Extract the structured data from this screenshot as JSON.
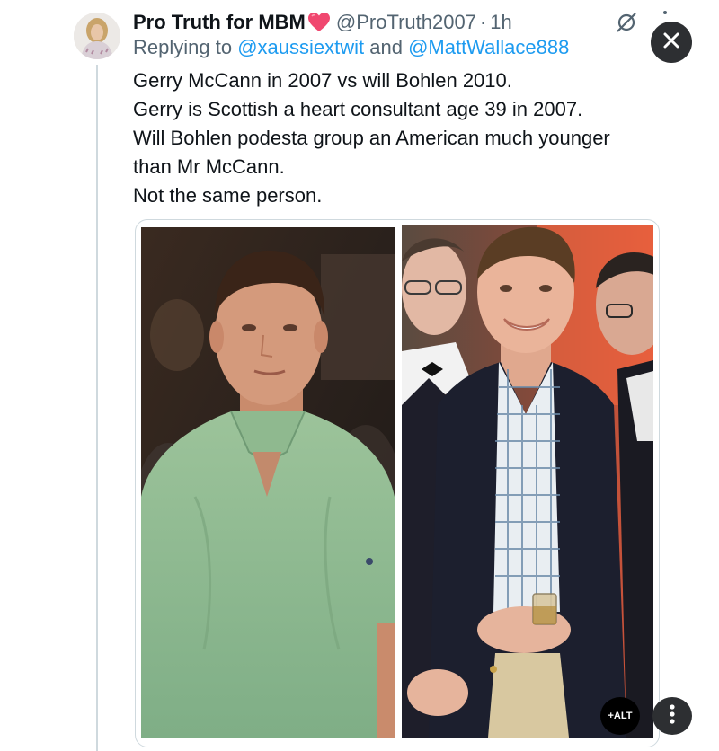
{
  "tweet": {
    "author": {
      "display_name": "Pro Truth for MBM",
      "handle": "@ProTruth2007",
      "separator": "·",
      "time": "1h"
    },
    "replying": {
      "prefix": "Replying to ",
      "mention_1": "@xaussiextwit",
      "conjunction": " and ",
      "mention_2": "@MattWallace888"
    },
    "text_lines": [
      "Gerry McCann in 2007 vs will Bohlen 2010.",
      "Gerry is Scottish a heart consultant age 39 in 2007.",
      "Will Bohlen podesta group an American much younger",
      "than Mr McCann.",
      "Not the same person."
    ]
  },
  "media": {
    "alt_label": "+ALT",
    "photos": [
      "left-photo",
      "right-photo"
    ]
  },
  "icons": {
    "heart": "heart-icon",
    "grok": "grok-icon",
    "close": "close-icon",
    "more": "more-vertical-icon"
  },
  "colors": {
    "link": "#1d9bf0",
    "secondary_text": "#536471",
    "primary_text": "#0f1419",
    "heart": "#f91880",
    "dark_button": "#2d2f32"
  }
}
